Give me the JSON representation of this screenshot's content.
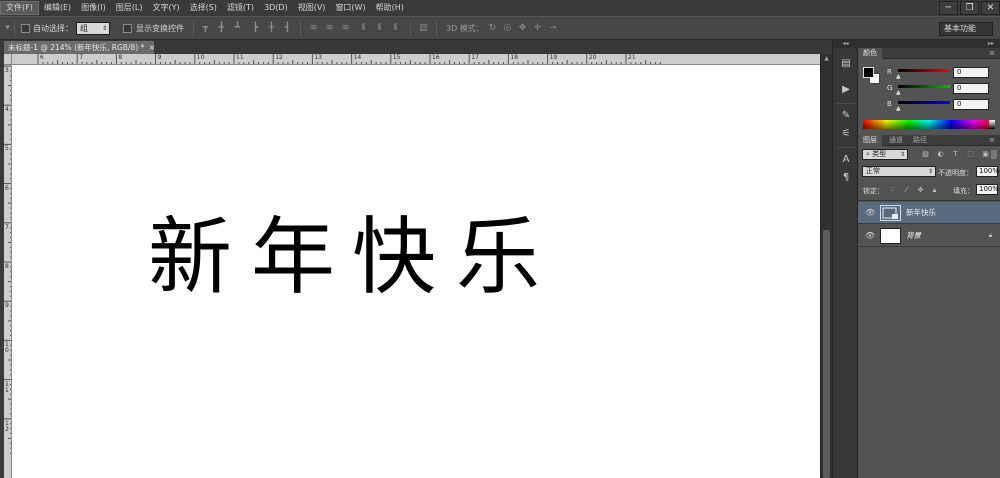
{
  "menu": [
    {
      "label": "文件(F)",
      "active": true
    },
    {
      "label": "编辑(E)"
    },
    {
      "label": "图像(I)"
    },
    {
      "label": "图层(L)"
    },
    {
      "label": "文字(Y)"
    },
    {
      "label": "选择(S)"
    },
    {
      "label": "滤镜(T)"
    },
    {
      "label": "3D(D)"
    },
    {
      "label": "视图(V)"
    },
    {
      "label": "窗口(W)"
    },
    {
      "label": "帮助(H)"
    }
  ],
  "window_controls": {
    "minimize": "─",
    "restore": "❐",
    "close": "✕"
  },
  "options_bar": {
    "auto_select_label": "自动选择：",
    "auto_select_value": "组",
    "show_transform_label": "显示变换控件",
    "mode_3d_label": "3D 模式：",
    "workspace": "基本功能"
  },
  "document_tab": {
    "title": "未标题-1 @ 214% (新年快乐, RGB/8) *",
    "close": "×"
  },
  "ruler_h": [
    "6",
    "7",
    "8",
    "9",
    "10",
    "11",
    "12",
    "13",
    "14",
    "15",
    "16",
    "17",
    "18",
    "19",
    "20",
    "21"
  ],
  "ruler_v": [
    "3",
    "4",
    "5",
    "6",
    "7",
    "8",
    "9",
    "1 0",
    "1 1",
    "1 2"
  ],
  "canvas_text": [
    "新",
    "年",
    "快",
    "乐"
  ],
  "dock": {
    "collapse": "◂◂",
    "expand": "▸▸"
  },
  "color_panel": {
    "tab": "颜色",
    "channels": [
      {
        "label": "R",
        "value": "0",
        "color": "#ff0000"
      },
      {
        "label": "G",
        "value": "0",
        "color": "#00c000"
      },
      {
        "label": "B",
        "value": "0",
        "color": "#0000ff"
      }
    ]
  },
  "layers_panel": {
    "tabs": [
      "图层",
      "通道",
      "路径"
    ],
    "filter_type": "类型",
    "blend_mode": "正常",
    "opacity_label": "不透明度：",
    "opacity_value": "100%",
    "lock_label": "锁定：",
    "fill_label": "填充：",
    "fill_value": "100%",
    "layers": [
      {
        "name": "新年快乐",
        "selected": true,
        "type": "smart-object"
      },
      {
        "name": "背景",
        "selected": false,
        "type": "background",
        "locked": true
      }
    ]
  }
}
